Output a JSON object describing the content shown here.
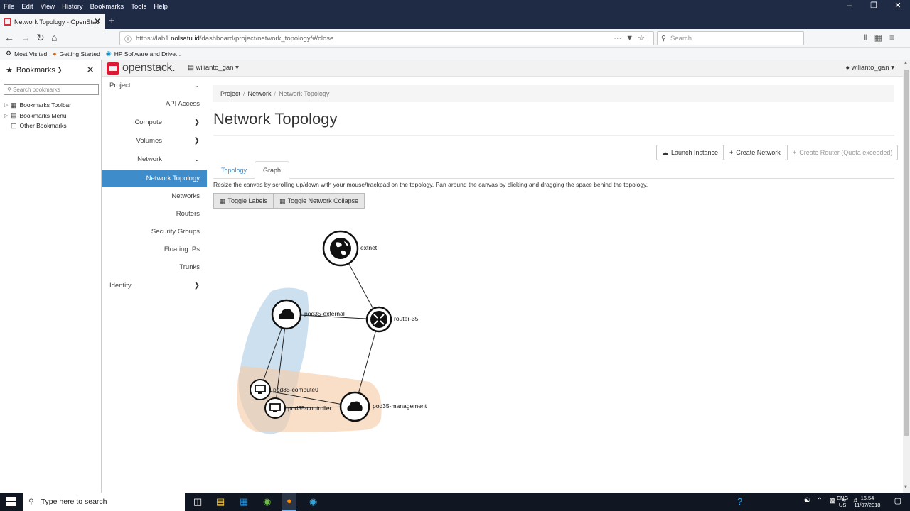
{
  "menubar": {
    "items": [
      "File",
      "Edit",
      "View",
      "History",
      "Bookmarks",
      "Tools",
      "Help"
    ]
  },
  "browser": {
    "tab_title": "Network Topology - OpenStac",
    "url_prefix": "https://lab1.",
    "url_domain": "nolsatu.id",
    "url_path": "/dashboard/project/network_topology/#/close",
    "search_placeholder": "Search"
  },
  "bookmarks_toolbar": [
    "Most Visited",
    "Getting Started",
    "HP Software and Drive..."
  ],
  "bookmarks_sidebar": {
    "title": "Bookmarks",
    "search_placeholder": "Search bookmarks",
    "items": [
      "Bookmarks Toolbar",
      "Bookmarks Menu",
      "Other Bookmarks"
    ]
  },
  "openstack": {
    "logo": "openstack.",
    "project": "wilianto_gan",
    "user": "wilianto_gan"
  },
  "nav": {
    "project": "Project",
    "api_access": "API Access",
    "compute": "Compute",
    "volumes": "Volumes",
    "network": "Network",
    "network_topology": "Network Topology",
    "networks": "Networks",
    "routers": "Routers",
    "security_groups": "Security Groups",
    "floating_ips": "Floating IPs",
    "trunks": "Trunks",
    "identity": "Identity"
  },
  "breadcrumb": {
    "project": "Project",
    "network": "Network",
    "current": "Network Topology"
  },
  "page": {
    "title": "Network Topology",
    "launch_instance": "Launch Instance",
    "create_network": "Create Network",
    "create_router": "Create Router (Quota exceeded)",
    "tab_topology": "Topology",
    "tab_graph": "Graph",
    "help": "Resize the canvas by scrolling up/down with your mouse/trackpad on the topology. Pan around the canvas by clicking and dragging the space behind the topology.",
    "toggle_labels": "Toggle Labels",
    "toggle_network_collapse": "Toggle Network Collapse"
  },
  "topology": {
    "extnet": "extnet",
    "router": "router-35",
    "pod_external": "pod35-external",
    "pod_management": "pod35-management",
    "compute0": "pod35-compute0",
    "controller": "pod35-controller"
  },
  "taskbar": {
    "search": "Type here to search",
    "lang1": "ENG",
    "lang2": "US",
    "time": "16.54",
    "date": "11/07/2018"
  }
}
